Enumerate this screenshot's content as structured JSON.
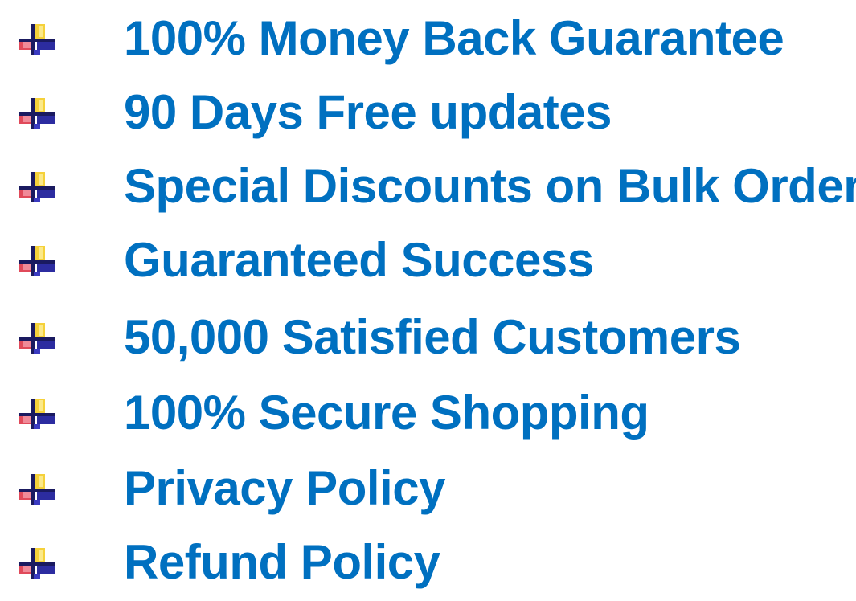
{
  "bullet_icon": "plus-cross-bullet-icon",
  "text_color": "#0070c0",
  "items": [
    {
      "label": "100% Money Back Guarantee"
    },
    {
      "label": "90 Days Free updates"
    },
    {
      "label": "Special Discounts on Bulk Orders"
    },
    {
      "label": "Guaranteed Success"
    },
    {
      "label": "50,000 Satisfied Customers"
    },
    {
      "label": "100% Secure Shopping"
    },
    {
      "label": "Privacy Policy"
    },
    {
      "label": "Refund Policy"
    }
  ]
}
